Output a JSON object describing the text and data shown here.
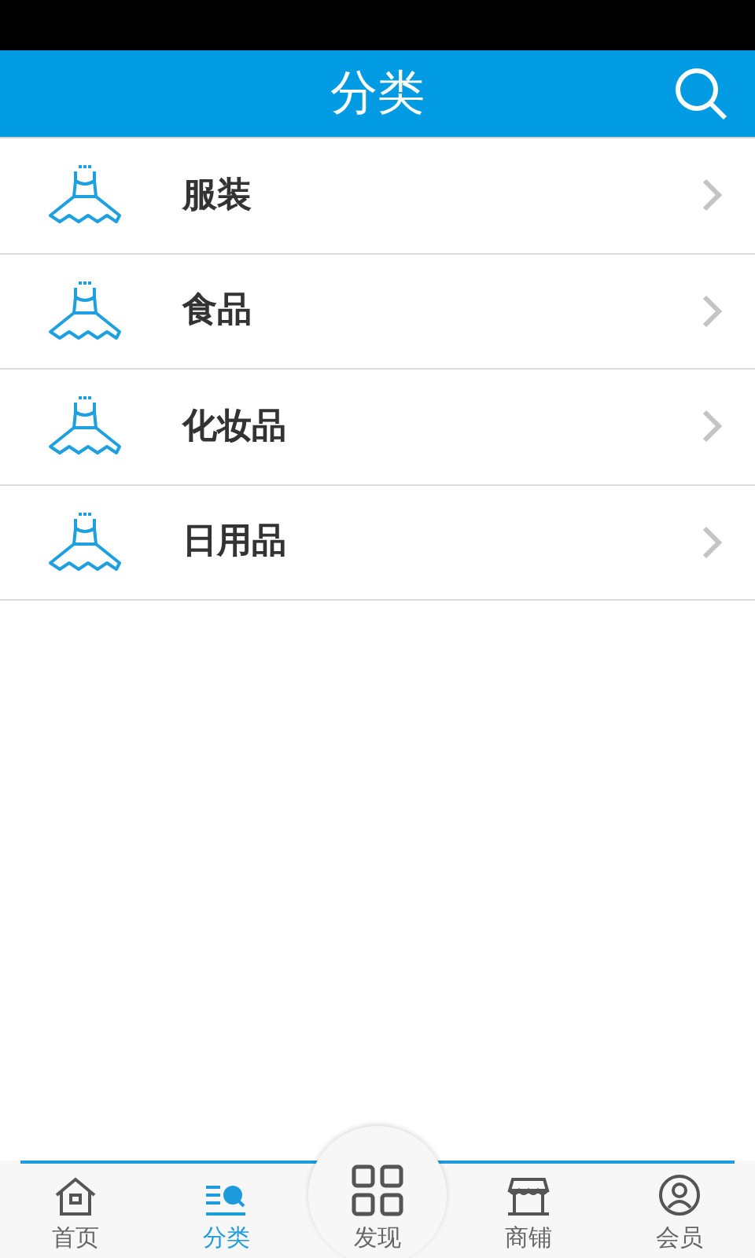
{
  "header": {
    "title": "分类"
  },
  "categories": [
    {
      "label": "服装"
    },
    {
      "label": "食品"
    },
    {
      "label": "化妆品"
    },
    {
      "label": "日用品"
    }
  ],
  "tabs": [
    {
      "kind": "home",
      "label": "首页",
      "selected": false
    },
    {
      "kind": "category",
      "label": "分类",
      "selected": true
    },
    {
      "kind": "discover",
      "label": "发现",
      "selected": false
    },
    {
      "kind": "shop",
      "label": "商铺",
      "selected": false
    },
    {
      "kind": "member",
      "label": "会员",
      "selected": false
    }
  ]
}
